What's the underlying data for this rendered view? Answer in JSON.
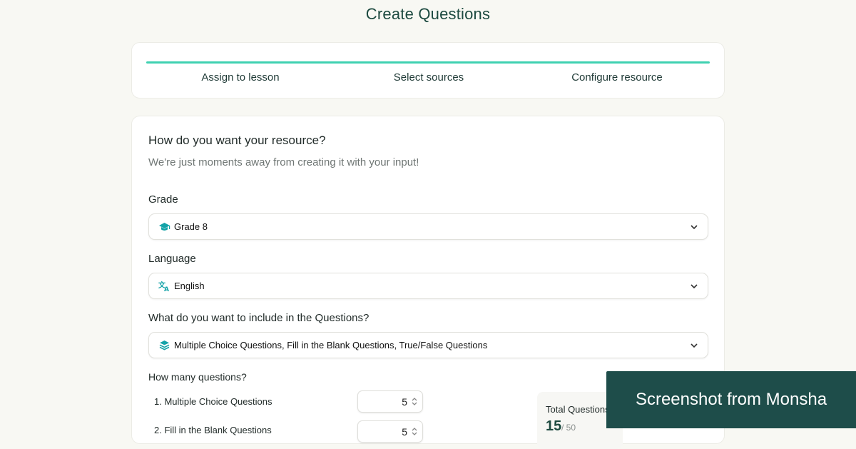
{
  "page": {
    "title": "Create Questions"
  },
  "stepper": {
    "steps": [
      "Assign to lesson",
      "Select sources",
      "Configure resource"
    ],
    "accent_color": "#3fd1b1"
  },
  "form": {
    "heading": "How do you want your resource?",
    "subheading": "We're just moments away from creating it with your input!",
    "grade": {
      "label": "Grade",
      "value": "Grade 8",
      "icon": "graduation-cap-icon"
    },
    "language": {
      "label": "Language",
      "value": "English",
      "icon": "translate-icon"
    },
    "include": {
      "label": "What do you want to include in the Questions?",
      "value": "Multiple Choice Questions, Fill in the Blank Questions, True/False Questions",
      "icon": "layers-icon"
    },
    "count": {
      "label": "How many questions?",
      "items": [
        {
          "label": "1. Multiple Choice Questions",
          "value": "5"
        },
        {
          "label": "2. Fill in the Blank Questions",
          "value": "5"
        }
      ],
      "total_label": "Total Questions",
      "total_value": "15",
      "total_max": "/ 50"
    }
  },
  "watermark": {
    "text": "Screenshot from Monsha",
    "background": "#1e4d4a"
  },
  "colors": {
    "icon_teal": "#14a3a8",
    "title_green": "#1d4a40"
  }
}
